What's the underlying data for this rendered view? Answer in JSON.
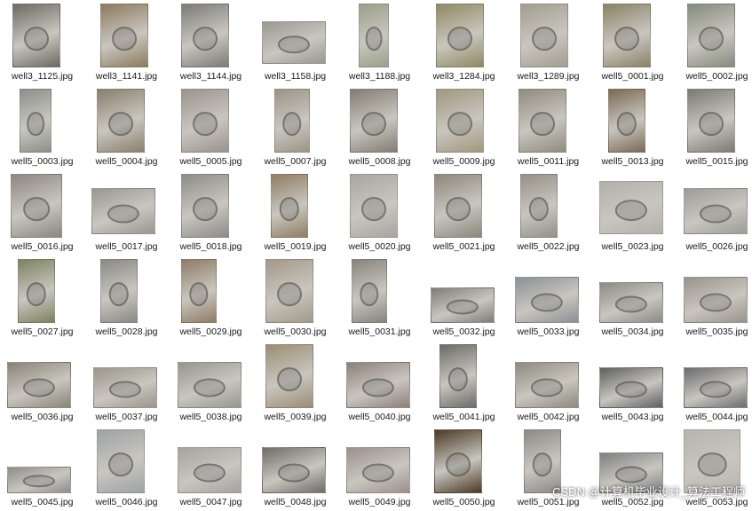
{
  "files": [
    {
      "name": "well3_1125.jpg",
      "tone": "#6b6a63"
    },
    {
      "name": "well3_1141.jpg",
      "tone": "#8c7a5e"
    },
    {
      "name": "well3_1144.jpg",
      "tone": "#7c7b76"
    },
    {
      "name": "well3_1158.jpg",
      "tone": "#9a9890"
    },
    {
      "name": "well3_1188.jpg",
      "tone": "#9aa08a"
    },
    {
      "name": "well3_1284.jpg",
      "tone": "#8f8a62"
    },
    {
      "name": "well3_1289.jpg",
      "tone": "#a39d90"
    },
    {
      "name": "well5_0001.jpg",
      "tone": "#8a8266"
    },
    {
      "name": "well5_0002.jpg",
      "tone": "#868a7e"
    },
    {
      "name": "well5_0003.jpg",
      "tone": "#8d8f8a"
    },
    {
      "name": "well5_0004.jpg",
      "tone": "#8a7f6c"
    },
    {
      "name": "well5_0005.jpg",
      "tone": "#9b938d"
    },
    {
      "name": "well5_0007.jpg",
      "tone": "#9c9486"
    },
    {
      "name": "well5_0008.jpg",
      "tone": "#827d72"
    },
    {
      "name": "well5_0009.jpg",
      "tone": "#a2977f"
    },
    {
      "name": "well5_0011.jpg",
      "tone": "#8f8b7f"
    },
    {
      "name": "well5_0013.jpg",
      "tone": "#7b6a55"
    },
    {
      "name": "well5_0015.jpg",
      "tone": "#7d7a74"
    },
    {
      "name": "well5_0016.jpg",
      "tone": "#8b8680"
    },
    {
      "name": "well5_0017.jpg",
      "tone": "#9a9590"
    },
    {
      "name": "well5_0018.jpg",
      "tone": "#8e8c88"
    },
    {
      "name": "well5_0019.jpg",
      "tone": "#8f7d64"
    },
    {
      "name": "well5_0020.jpg",
      "tone": "#a8a6a0"
    },
    {
      "name": "well5_0021.jpg",
      "tone": "#8d877c"
    },
    {
      "name": "well5_0022.jpg",
      "tone": "#949088"
    },
    {
      "name": "well5_0023.jpg",
      "tone": "#b2b0a9"
    },
    {
      "name": "well5_0026.jpg",
      "tone": "#9c9b97"
    },
    {
      "name": "well5_0027.jpg",
      "tone": "#7d8260"
    },
    {
      "name": "well5_0028.jpg",
      "tone": "#8a8984"
    },
    {
      "name": "well5_0029.jpg",
      "tone": "#8e7c66"
    },
    {
      "name": "well5_0030.jpg",
      "tone": "#a3998a"
    },
    {
      "name": "well5_0031.jpg",
      "tone": "#87837d"
    },
    {
      "name": "well5_0032.jpg",
      "tone": "#7e7c78"
    },
    {
      "name": "well5_0033.jpg",
      "tone": "#8c8f96"
    },
    {
      "name": "well5_0034.jpg",
      "tone": "#8d8a85"
    },
    {
      "name": "well5_0035.jpg",
      "tone": "#99928a"
    },
    {
      "name": "well5_0036.jpg",
      "tone": "#8a8276"
    },
    {
      "name": "well5_0037.jpg",
      "tone": "#9b9589"
    },
    {
      "name": "well5_0038.jpg",
      "tone": "#979590"
    },
    {
      "name": "well5_0039.jpg",
      "tone": "#9a8d74"
    },
    {
      "name": "well5_0040.jpg",
      "tone": "#8c7f7a"
    },
    {
      "name": "well5_0041.jpg",
      "tone": "#6d6b68"
    },
    {
      "name": "well5_0042.jpg",
      "tone": "#8e897e"
    },
    {
      "name": "well5_0043.jpg",
      "tone": "#5d5e60"
    },
    {
      "name": "well5_0044.jpg",
      "tone": "#6a6b6d"
    },
    {
      "name": "well5_0045.jpg",
      "tone": "#8f8d8a"
    },
    {
      "name": "well5_0046.jpg",
      "tone": "#9ea2a6"
    },
    {
      "name": "well5_0047.jpg",
      "tone": "#a5a39e"
    },
    {
      "name": "well5_0048.jpg",
      "tone": "#6f6c68"
    },
    {
      "name": "well5_0049.jpg",
      "tone": "#9c908c"
    },
    {
      "name": "well5_0050.jpg",
      "tone": "#4a3a25"
    },
    {
      "name": "well5_0051.jpg",
      "tone": "#8c8a86"
    },
    {
      "name": "well5_0052.jpg",
      "tone": "#7f7f82"
    },
    {
      "name": "well5_0053.jpg",
      "tone": "#b7b4ae"
    }
  ],
  "watermark": "CSDN @计算机毕业设计_算法工程师"
}
